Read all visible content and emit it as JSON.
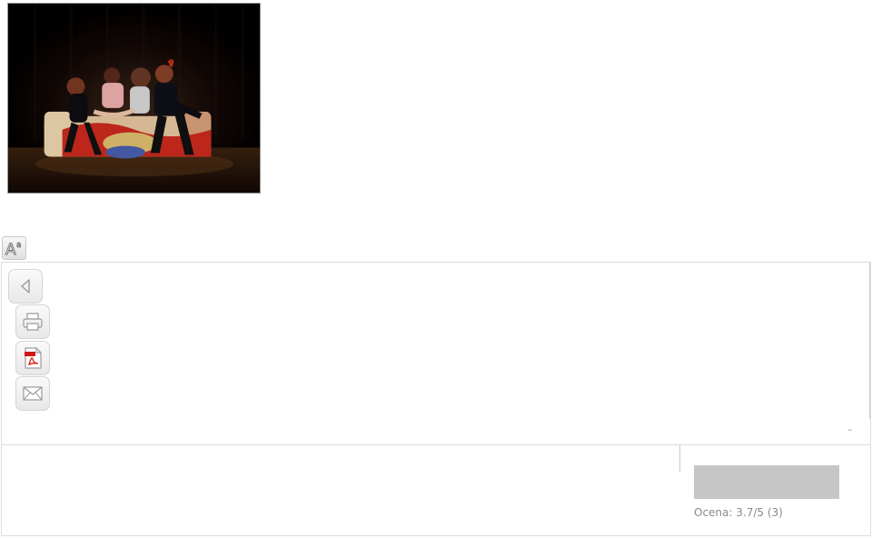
{
  "photo": {
    "alt": "Dancers on stage",
    "icon": "stage-photo"
  },
  "toolbar": {
    "font_size_icon": "font-size-icon",
    "back_icon": "back-arrow-icon",
    "print_icon": "print-icon",
    "pdf_icon": "pdf-icon",
    "email_icon": "email-icon"
  },
  "content": {
    "dash": "–"
  },
  "rating": {
    "label": "Ocena: 3.7/5 (3)"
  },
  "colors": {
    "rating_bar": "#c6c6c6",
    "border": "#dcdcdc",
    "text_muted": "#8a8a8a"
  }
}
